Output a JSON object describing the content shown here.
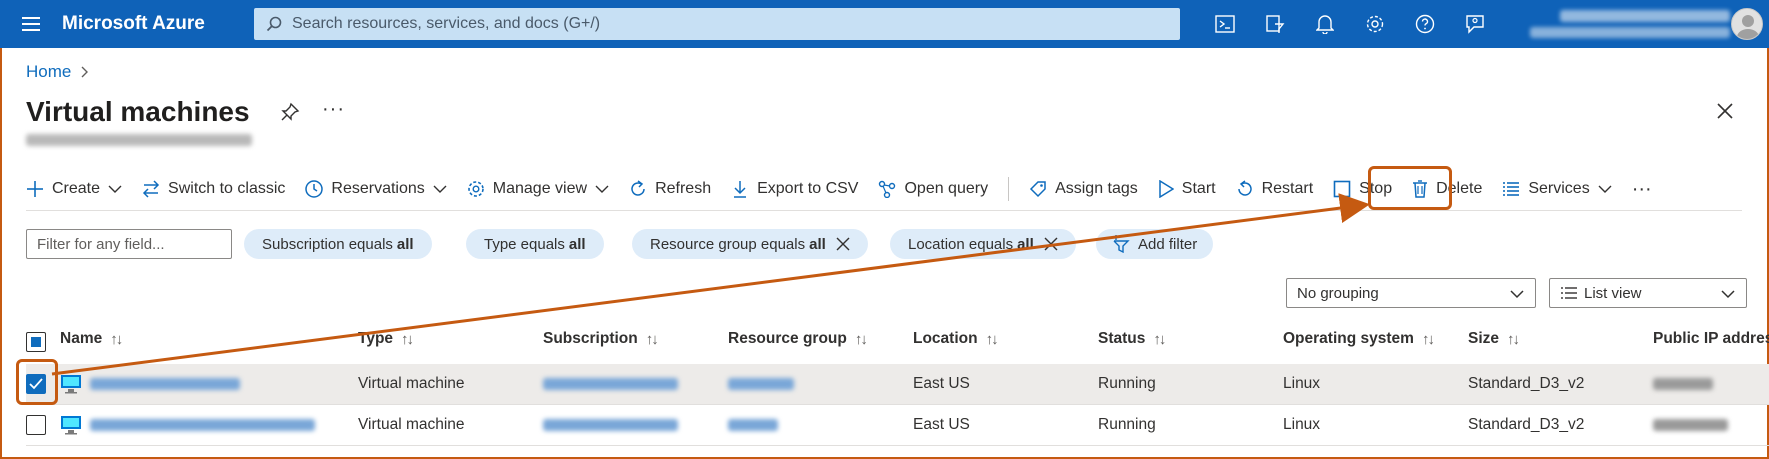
{
  "topbar": {
    "brand": "Microsoft Azure",
    "search_placeholder": "Search resources, services, and docs (G+/)"
  },
  "breadcrumb": {
    "home": "Home",
    "separator": ">"
  },
  "page": {
    "title": "Virtual machines",
    "more": "···"
  },
  "toolbar": {
    "create": "Create",
    "switch_to_classic": "Switch to classic",
    "reservations": "Reservations",
    "manage_view": "Manage view",
    "refresh": "Refresh",
    "export_csv": "Export to CSV",
    "open_query": "Open query",
    "assign_tags": "Assign tags",
    "start": "Start",
    "restart": "Restart",
    "stop": "Stop",
    "delete": "Delete",
    "services": "Services",
    "more": "···"
  },
  "filters": {
    "placeholder": "Filter for any field...",
    "pills": [
      {
        "label": "Subscription equals",
        "value": "all"
      },
      {
        "label": "Type equals",
        "value": "all"
      },
      {
        "label": "Resource group equals",
        "value": "all"
      },
      {
        "label": "Location equals",
        "value": "all"
      }
    ],
    "add_filter": "Add filter"
  },
  "view": {
    "grouping": "No grouping",
    "list_view": "List view"
  },
  "table": {
    "columns": [
      "Name",
      "Type",
      "Subscription",
      "Resource group",
      "Location",
      "Status",
      "Operating system",
      "Size",
      "Public IP address"
    ],
    "rows": [
      {
        "type": "Virtual machine",
        "location": "East US",
        "status": "Running",
        "os": "Linux",
        "size": "Standard_D3_v2",
        "selected": true
      },
      {
        "type": "Virtual machine",
        "location": "East US",
        "status": "Running",
        "os": "Linux",
        "size": "Standard_D3_v2",
        "selected": false
      }
    ]
  },
  "colors": {
    "topbar": "#0f62b8",
    "accent": "#0f6cbd",
    "highlight": "#c55a11",
    "pill": "#deecf9"
  }
}
